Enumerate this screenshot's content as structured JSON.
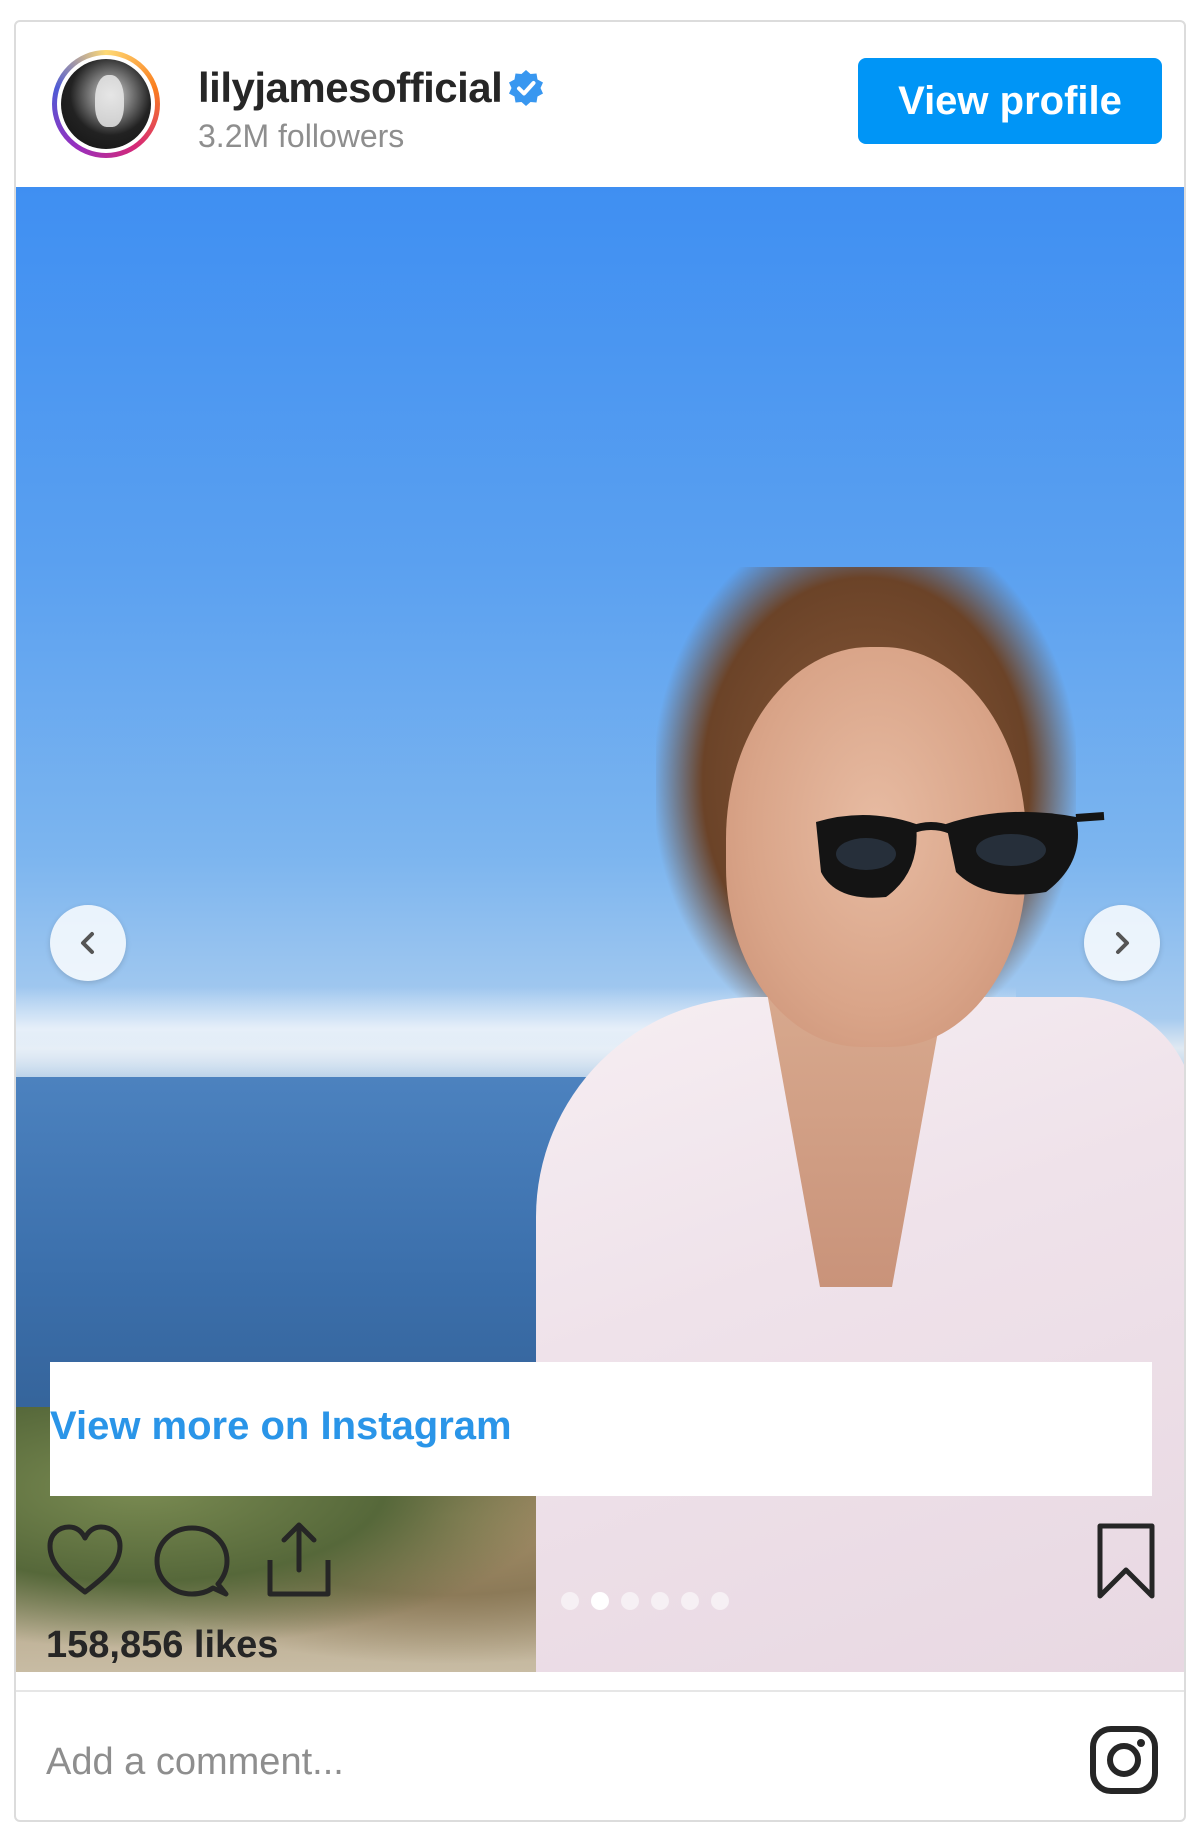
{
  "header": {
    "username": "lilyjamesofficial",
    "verified": true,
    "followers": "3.2M followers",
    "view_profile_label": "View profile"
  },
  "post": {
    "view_more_label": "View more on Instagram",
    "likes": "158,856 likes",
    "carousel": {
      "total_slides": 6,
      "active_index": 1
    }
  },
  "comment": {
    "placeholder": "Add a comment..."
  },
  "icons": {
    "verified": "verified-badge-icon",
    "prev": "chevron-left-icon",
    "next": "chevron-right-icon",
    "like": "heart-icon",
    "comment": "comment-bubble-icon",
    "share": "share-icon",
    "save": "bookmark-icon",
    "brand": "instagram-logo-icon"
  },
  "colors": {
    "accent": "#0095f6",
    "link": "#2a95e8",
    "text": "#262626",
    "muted": "#8e8e8e"
  }
}
